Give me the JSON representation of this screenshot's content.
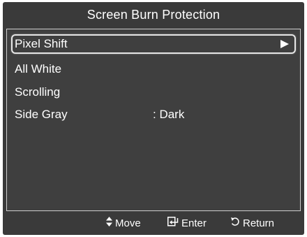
{
  "title": "Screen Burn Protection",
  "menu": {
    "items": [
      {
        "label": "Pixel Shift",
        "value": "",
        "selected": true
      },
      {
        "label": "All White",
        "value": "",
        "selected": false
      },
      {
        "label": "Scrolling",
        "value": "",
        "selected": false
      },
      {
        "label": "Side Gray",
        "value": ": Dark",
        "selected": false
      }
    ]
  },
  "footer": {
    "move_label": "Move",
    "enter_label": "Enter",
    "return_label": "Return",
    "icons": [
      "up-down-arrows-icon",
      "enter-icon",
      "return-icon"
    ]
  },
  "colors": {
    "background": "#3a3a3a",
    "panel": "#3f3f3f",
    "text": "#ffffff",
    "border": "#cfcfcf"
  }
}
